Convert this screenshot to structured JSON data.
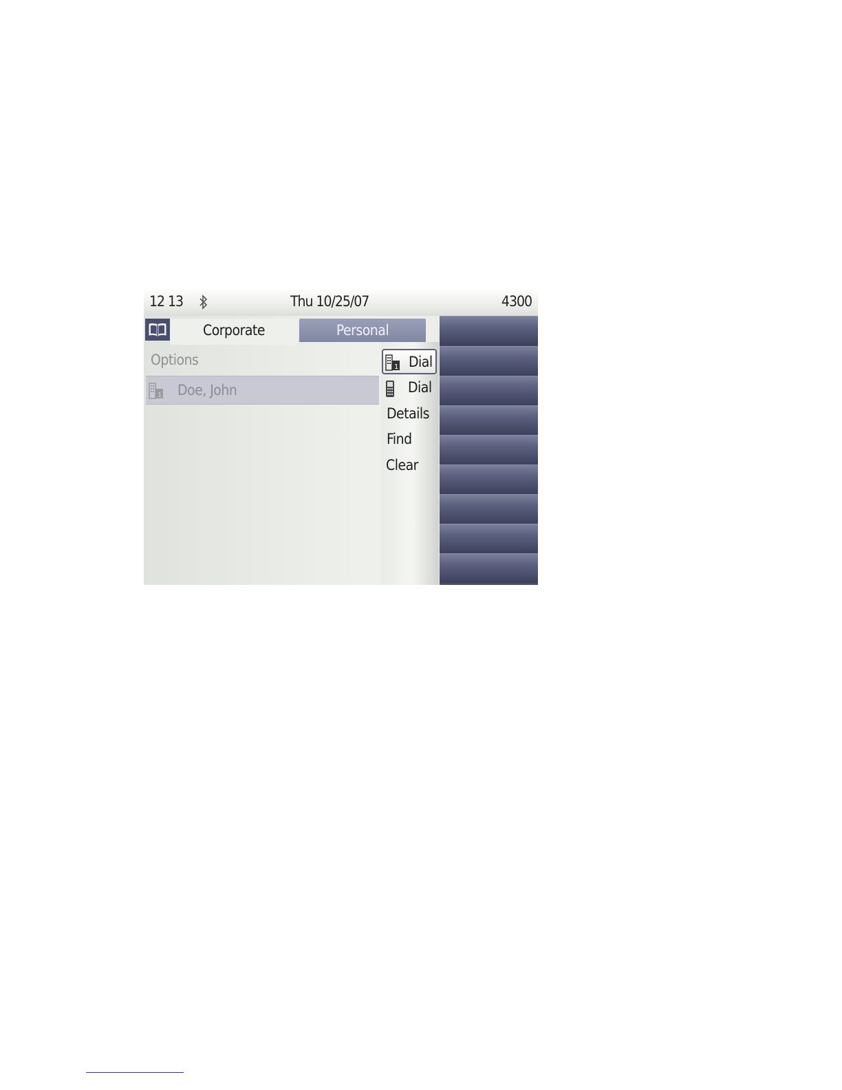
{
  "status_bar": {
    "time": "12 13",
    "bluetooth_icon": "bluetooth-icon",
    "date": "Thu 10/25/07",
    "extension": "4300"
  },
  "tabs": {
    "book_icon": "phonebook-icon",
    "items": [
      {
        "label": "Corporate",
        "active": true
      },
      {
        "label": "Personal",
        "active": false
      }
    ]
  },
  "context": {
    "options_label": "Options"
  },
  "list": {
    "items": [
      {
        "name": "Doe, John",
        "icon": "business-phone-icon",
        "selected": true
      }
    ]
  },
  "menu": {
    "items": [
      {
        "label": "Dial",
        "icon": "business-phone-icon",
        "selected": true
      },
      {
        "label": "Dial",
        "icon": "mobile-phone-icon",
        "selected": false
      },
      {
        "label": "Details",
        "selected": false
      },
      {
        "label": "Find",
        "selected": false
      },
      {
        "label": "Clear",
        "selected": false
      }
    ]
  },
  "colors": {
    "softkey_dark": "#4a4e6a",
    "tab_inactive": "#8186a3",
    "selection_bar": "#c8c9d2"
  }
}
